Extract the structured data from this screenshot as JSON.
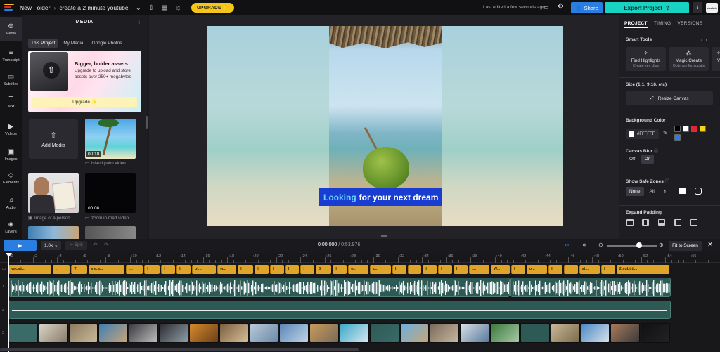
{
  "topbar": {
    "folder": "New Folder",
    "separator": "›",
    "project_name": "create a 2 minute youtube",
    "upgrade_label": "UPGRADE ⚡",
    "last_edited": "Last edited a few seconds ago",
    "share_label": "Share",
    "export_label": "Export Project",
    "avatar_text": "pixelniy"
  },
  "rail": [
    {
      "name": "Media",
      "icon": "media-icon"
    },
    {
      "name": "Transcript",
      "icon": "transcript-icon"
    },
    {
      "name": "Subtitles",
      "icon": "subtitles-icon"
    },
    {
      "name": "Text",
      "icon": "text-icon"
    },
    {
      "name": "Videos",
      "icon": "videos-icon"
    },
    {
      "name": "Images",
      "icon": "images-icon"
    },
    {
      "name": "Elements",
      "icon": "elements-icon"
    },
    {
      "name": "Audio",
      "icon": "audio-icon"
    },
    {
      "name": "Layers",
      "icon": "layers-icon"
    }
  ],
  "media": {
    "title": "MEDIA",
    "tabs": [
      "This Project",
      "My Media",
      "Google Photos"
    ],
    "promo_title": "Bigger, bolder assets",
    "promo_text": "Upgrade to upload and store assets over 250+ megabytes",
    "promo_button": "Upgrade ✨",
    "add_media": "Add Media",
    "items": [
      {
        "duration": "00:18",
        "caption": "island palm video"
      },
      {
        "duration": "",
        "caption": "Image of a person..."
      },
      {
        "duration": "00:08",
        "caption": "zoom in road video"
      }
    ]
  },
  "canvas": {
    "caption_highlight": "Looking",
    "caption_rest": "for your next dream"
  },
  "props": {
    "tabs": [
      "PROJECT",
      "TIMING",
      "VERSIONS"
    ],
    "smart_tools_label": "Smart Tools",
    "tools": [
      {
        "title": "Find Highlights",
        "sub": "Create key clips"
      },
      {
        "title": "Magic Create",
        "sub": "Optimize for socials"
      }
    ],
    "size_label": "Size (1:1, 9:16, etc)",
    "resize_label": "Resize Canvas",
    "bg_label": "Background Color",
    "bg_hex": "#FFFFFF",
    "swatches": [
      "#000000",
      "#ffffff",
      "#e0243a",
      "#f5d518",
      "#2a7de1"
    ],
    "blur_label": "Canvas Blur",
    "blur_options": [
      "Off",
      "On"
    ],
    "blur_selected": "On",
    "safe_label": "Show Safe Zones",
    "safe_options": [
      "None",
      "All"
    ],
    "safe_selected": "None",
    "padding_label": "Expand Padding"
  },
  "transport": {
    "speed": "1.0x",
    "split": "✂ Split",
    "time_current": "0:00.000",
    "time_total": "/ 0:53.976",
    "fit_label": "Fit to Screen"
  },
  "ruler": [
    ":0",
    ":2",
    ":4",
    ":6",
    ":8",
    ":10",
    ":12",
    ":14",
    ":16",
    ":18",
    ":20",
    ":22",
    ":24",
    ":26",
    ":28",
    ":30",
    ":32",
    ":34",
    ":36",
    ":38",
    ":40",
    ":42",
    ":44",
    ":46",
    ":48",
    ":50",
    ":52",
    ":54",
    ":56"
  ],
  "tracks": {
    "numbers": [
      "1",
      "2",
      "3"
    ],
    "subtitles": [
      "vacati...",
      "t",
      "T",
      "vaca...",
      "I...",
      "I",
      "I",
      "I",
      "of...",
      "w...",
      "I",
      "I",
      "I",
      "I",
      "I",
      "5",
      "I",
      "o...",
      "c...",
      "I",
      "I",
      "I",
      "I",
      "I",
      "t...",
      "W...",
      "I",
      "o...",
      "I",
      "I",
      "st...",
      "I",
      "2 subtitl..."
    ]
  }
}
